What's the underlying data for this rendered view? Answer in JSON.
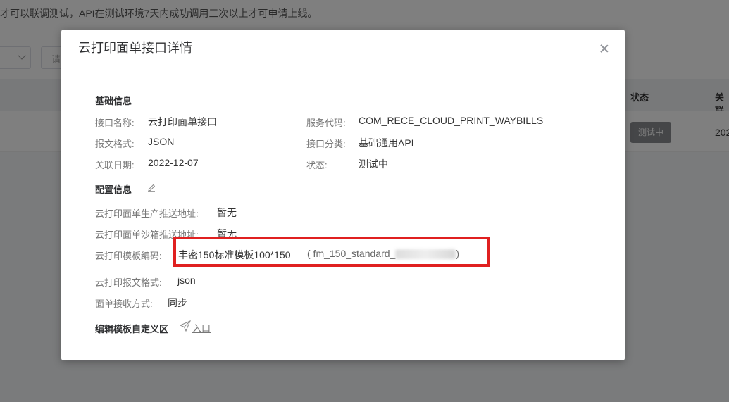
{
  "background": {
    "notice": "才可以联调测试，API在测试环境7天内成功调用三次以上才可申请上线。",
    "input_placeholder": "请",
    "table_headers": {
      "status": "状态",
      "related": "关联"
    },
    "row": {
      "status_badge": "测试中",
      "date_partial": "202"
    }
  },
  "modal": {
    "title": "云打印面单接口详情",
    "basic_section": {
      "title": "基础信息",
      "api_name_label": "接口名称:",
      "api_name_value": "云打印面单接口",
      "service_code_label": "服务代码:",
      "service_code_value": "COM_RECE_CLOUD_PRINT_WAYBILLS",
      "format_label": "报文格式:",
      "format_value": "JSON",
      "category_label": "接口分类:",
      "category_value": "基础通用API",
      "date_label": "关联日期:",
      "date_value": "2022-12-07",
      "status_label": "状态:",
      "status_value": "测试中"
    },
    "config_section": {
      "title": "配置信息",
      "prod_push_label": "云打印面单生产推送地址:",
      "prod_push_value": "暂无",
      "sandbox_push_label": "云打印面单沙箱推送地址:",
      "sandbox_push_value": "暂无",
      "template_code_label": "云打印模板编码:",
      "template_code_value": "丰密150标准模板100*150",
      "template_code_id": "( fm_150_standard_",
      "template_code_end": ")",
      "msg_format_label": "云打印报文格式:",
      "msg_format_value": "json",
      "receive_mode_label": "面单接收方式:",
      "receive_mode_value": "同步"
    },
    "custom_section": {
      "title": "编辑模板自定义区",
      "entry_link": "入口"
    }
  },
  "colors": {
    "highlight": "#e02020",
    "badge": "#8a8d91"
  },
  "icons": [
    "close-icon",
    "edit-icon",
    "send-icon",
    "chevron-down-icon"
  ]
}
